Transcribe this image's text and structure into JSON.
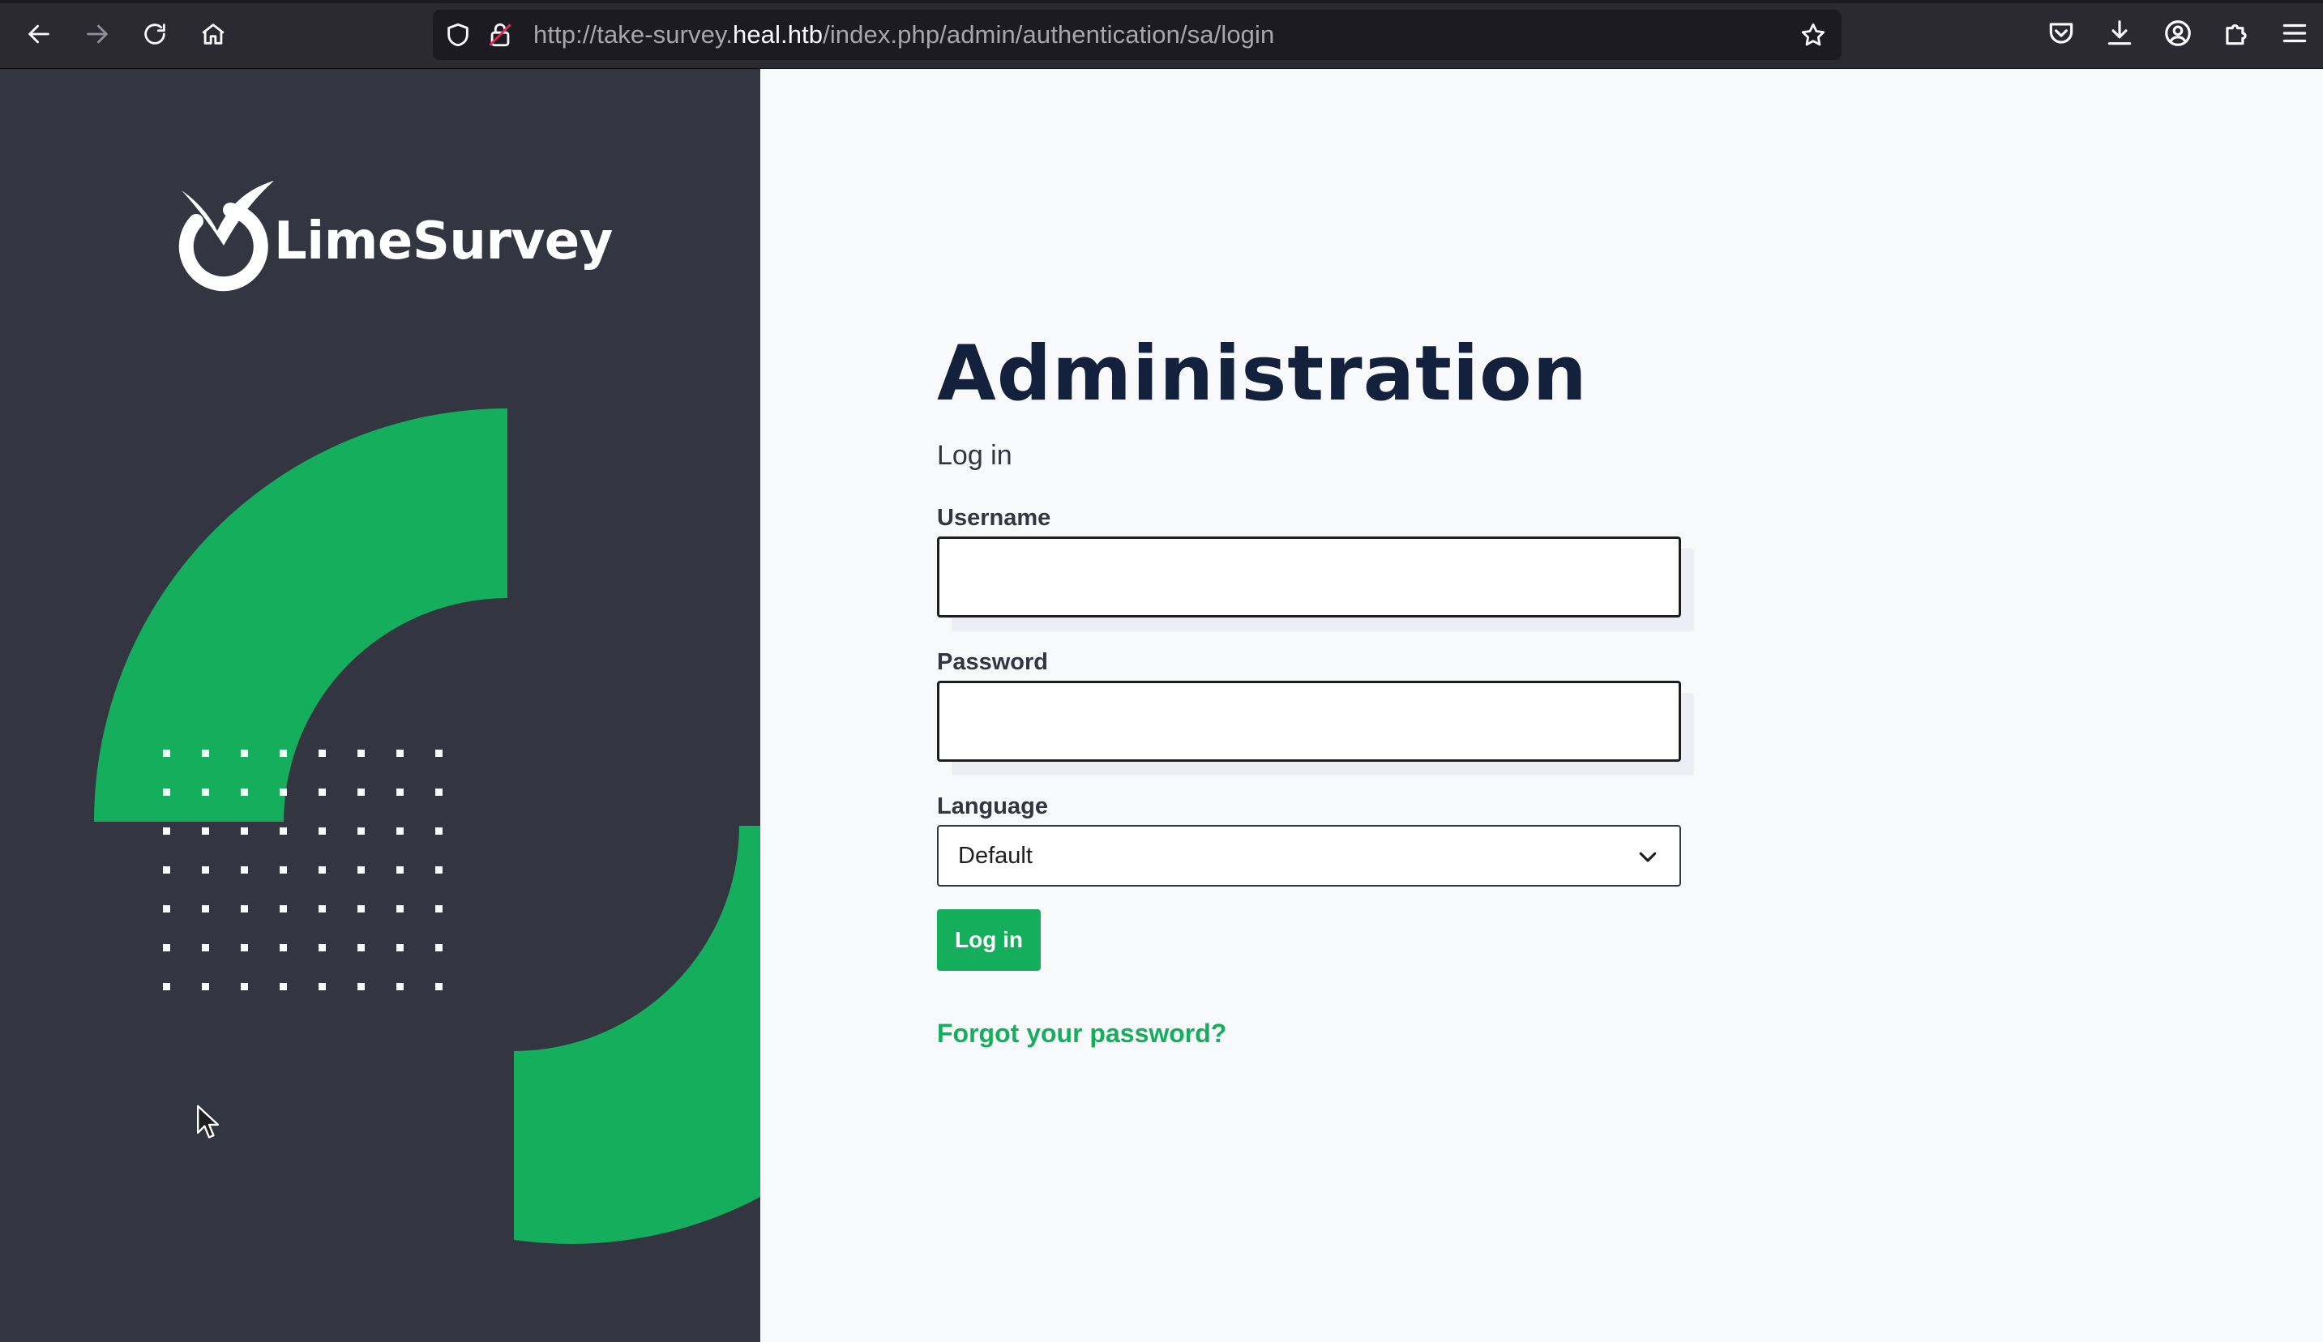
{
  "browser": {
    "url_prefix": "http://take-survey.",
    "url_host": "heal.htb",
    "url_path": "/index.php/admin/authentication/sa/login",
    "icons": {
      "back": "arrow-left-icon",
      "forward": "arrow-right-icon",
      "reload": "reload-icon",
      "home": "home-icon",
      "shield": "shield-icon",
      "lock": "lock-insecure-icon",
      "bookmark": "star-icon",
      "pocket": "pocket-icon",
      "downloads": "download-icon",
      "account": "account-icon",
      "extensions": "puzzle-icon",
      "menu": "hamburger-menu-icon"
    }
  },
  "brand": {
    "logo_text": "LimeSurvey",
    "accent_color": "#14ae5c",
    "panel_color": "#333641"
  },
  "login": {
    "title": "Administration",
    "subtitle": "Log in",
    "username_label": "Username",
    "username_value": "",
    "password_label": "Password",
    "password_value": "",
    "language_label": "Language",
    "language_selected": "Default",
    "submit_label": "Log in",
    "forgot_link": "Forgot your password?"
  }
}
